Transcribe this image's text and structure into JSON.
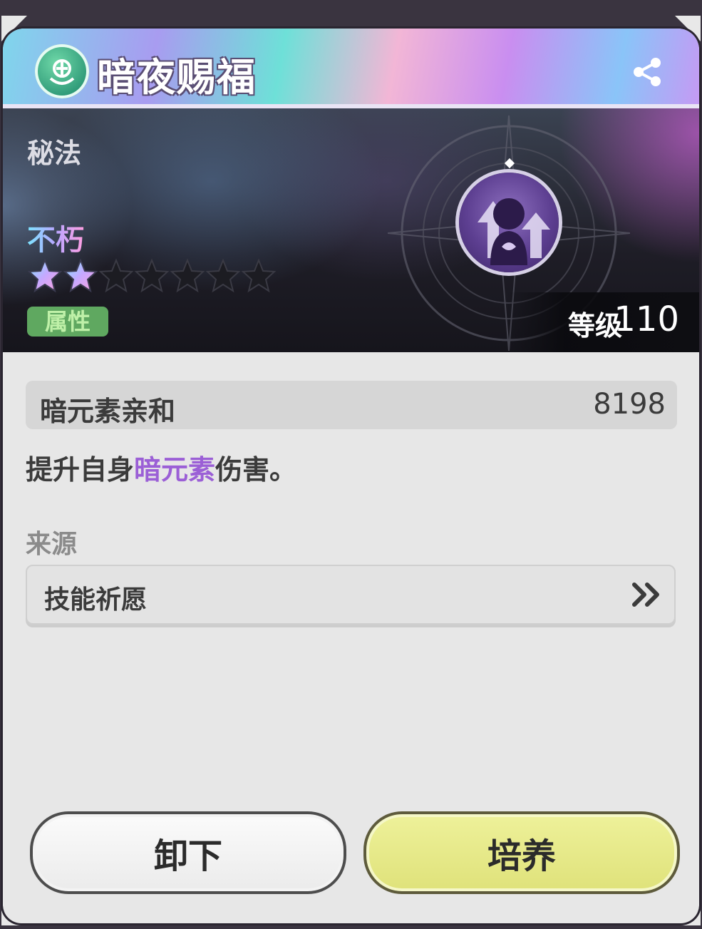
{
  "header": {
    "title": "暗夜赐福"
  },
  "banner": {
    "category": "秘法",
    "rarity": "不朽",
    "stars": {
      "filled": 2,
      "total": 7
    },
    "attribute_badge": "属性",
    "level_label": "等级",
    "level_value": "110"
  },
  "stat": {
    "name": "暗元素亲和",
    "value": "8198"
  },
  "description": {
    "prefix": "提升自身",
    "highlight": "暗元素",
    "suffix": "伤害。"
  },
  "source": {
    "label": "来源",
    "item": "技能祈愿"
  },
  "buttons": {
    "unload": "卸下",
    "train": "培养"
  },
  "colors": {
    "highlight": "#9b5fd6",
    "attribute_badge": "#5fa860",
    "train_button": "#e6e987"
  }
}
